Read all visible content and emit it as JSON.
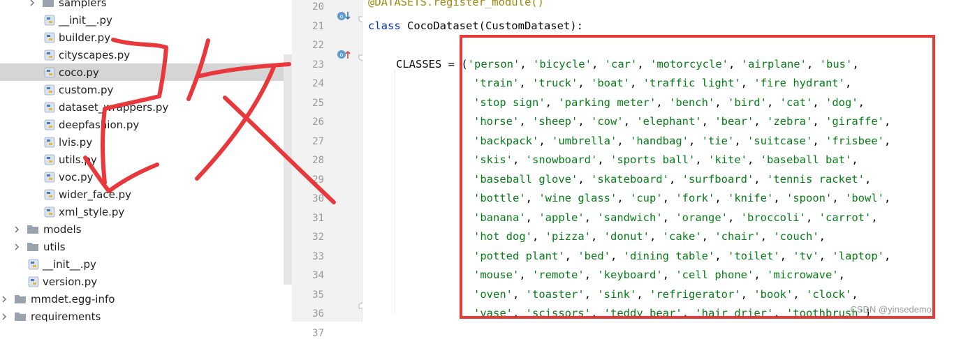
{
  "tree": {
    "items": [
      {
        "label": "samplers",
        "type": "folder",
        "expand": "right"
      },
      {
        "label": "__init__.py",
        "type": "py"
      },
      {
        "label": "builder.py",
        "type": "py"
      },
      {
        "label": "cityscapes.py",
        "type": "py"
      },
      {
        "label": "coco.py",
        "type": "py",
        "selected": true
      },
      {
        "label": "custom.py",
        "type": "py"
      },
      {
        "label": "dataset_wrappers.py",
        "type": "py"
      },
      {
        "label": "deepfashion.py",
        "type": "py"
      },
      {
        "label": "lvis.py",
        "type": "py"
      },
      {
        "label": "utils.py",
        "type": "py"
      },
      {
        "label": "voc.py",
        "type": "py"
      },
      {
        "label": "wider_face.py",
        "type": "py"
      },
      {
        "label": "xml_style.py",
        "type": "py"
      },
      {
        "label": "models",
        "type": "folder",
        "expand": "right"
      },
      {
        "label": "utils",
        "type": "folder",
        "expand": "right"
      },
      {
        "label": "__init__.py",
        "type": "py"
      },
      {
        "label": "version.py",
        "type": "py"
      },
      {
        "label": "mmdet.egg-info",
        "type": "folder",
        "expand": "right"
      },
      {
        "label": "requirements",
        "type": "folder",
        "expand": "right"
      }
    ]
  },
  "editor": {
    "line_numbers": [
      "20",
      "21",
      "22",
      "23",
      "24",
      "25",
      "26",
      "27",
      "28",
      "29",
      "30",
      "31",
      "32",
      "33",
      "34",
      "35",
      "36",
      "37"
    ],
    "top_partial": "@DATASETS.register_module()",
    "class_kw": "class",
    "class_rest": " CocoDataset(CustomDataset):",
    "classes_prefix": "CLASSES = (",
    "class_lines": [
      [
        "'person'",
        "'bicycle'",
        "'car'",
        "'motorcycle'",
        "'airplane'",
        "'bus'"
      ],
      [
        "'train'",
        "'truck'",
        "'boat'",
        "'traffic light'",
        "'fire hydrant'"
      ],
      [
        "'stop sign'",
        "'parking meter'",
        "'bench'",
        "'bird'",
        "'cat'",
        "'dog'"
      ],
      [
        "'horse'",
        "'sheep'",
        "'cow'",
        "'elephant'",
        "'bear'",
        "'zebra'",
        "'giraffe'"
      ],
      [
        "'backpack'",
        "'umbrella'",
        "'handbag'",
        "'tie'",
        "'suitcase'",
        "'frisbee'"
      ],
      [
        "'skis'",
        "'snowboard'",
        "'sports ball'",
        "'kite'",
        "'baseball bat'"
      ],
      [
        "'baseball glove'",
        "'skateboard'",
        "'surfboard'",
        "'tennis racket'"
      ],
      [
        "'bottle'",
        "'wine glass'",
        "'cup'",
        "'fork'",
        "'knife'",
        "'spoon'",
        "'bowl'"
      ],
      [
        "'banana'",
        "'apple'",
        "'sandwich'",
        "'orange'",
        "'broccoli'",
        "'carrot'"
      ],
      [
        "'hot dog'",
        "'pizza'",
        "'donut'",
        "'cake'",
        "'chair'",
        "'couch'"
      ],
      [
        "'potted plant'",
        "'bed'",
        "'dining table'",
        "'toilet'",
        "'tv'",
        "'laptop'"
      ],
      [
        "'mouse'",
        "'remote'",
        "'keyboard'",
        "'cell phone'",
        "'microwave'"
      ],
      [
        "'oven'",
        "'toaster'",
        "'sink'",
        "'refrigerator'",
        "'book'",
        "'clock'"
      ],
      [
        "'vase'",
        "'scissors'",
        "'teddy bear'",
        "'hair drier'",
        "'toothbrush'"
      ]
    ],
    "closing": ")"
  },
  "watermark": "CSDN @yinsedemo",
  "colors": {
    "keyword": "#0033b3",
    "string": "#067d17",
    "highlight_box": "#e53a3a",
    "annotation_stroke": "#e8383b",
    "selected_row": "#d5d5d5"
  }
}
